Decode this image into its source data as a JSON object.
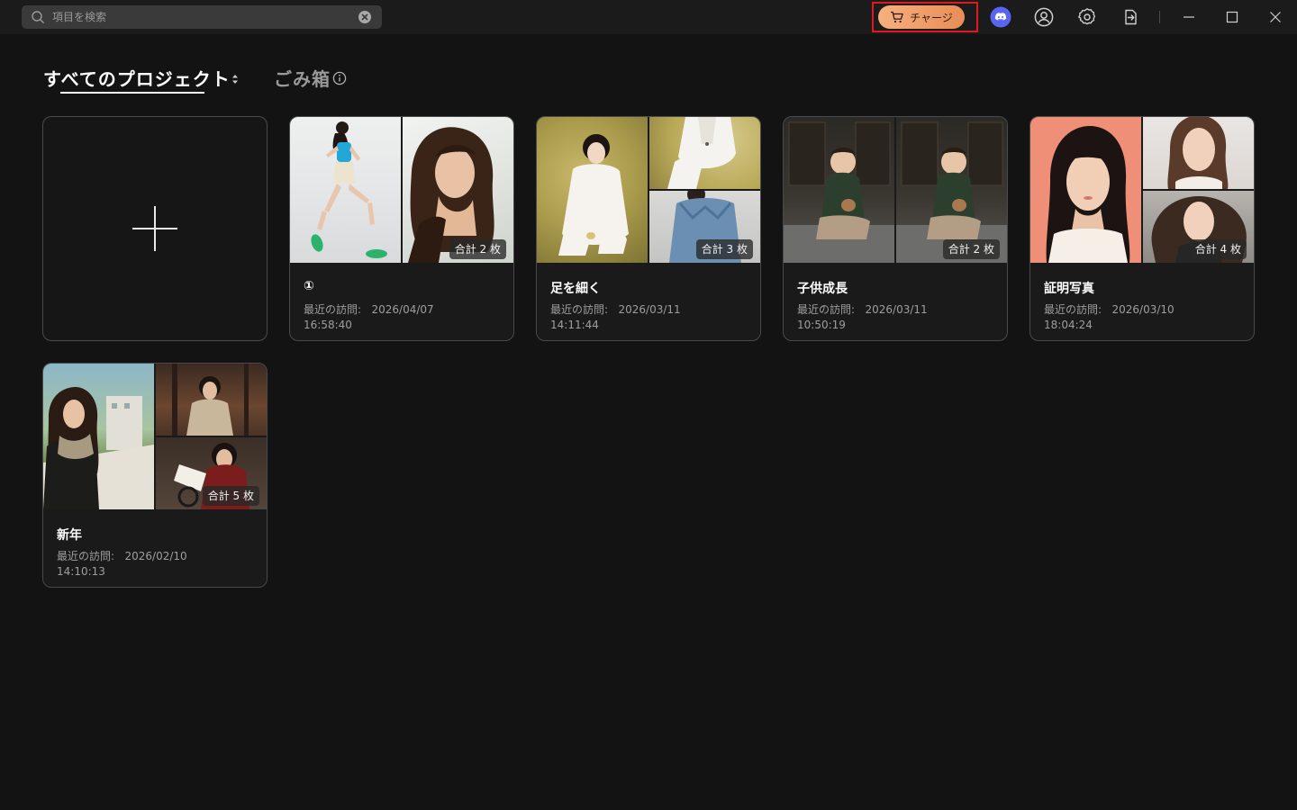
{
  "search": {
    "placeholder": "項目を検索",
    "value": ""
  },
  "header": {
    "charge_label": "チャージ",
    "charge_color": "#ec9662",
    "highlight_color": "#e0191c",
    "icons": [
      "shopping-cart-icon",
      "discord-icon",
      "account-icon",
      "settings-icon",
      "export-icon",
      "minimize-icon",
      "maximize-icon",
      "close-icon"
    ]
  },
  "tabs": {
    "all_projects": "すべてのプロジェクト",
    "trash": "ごみ箱"
  },
  "visit_label": "最近の訪問:",
  "projects": [
    {
      "title": "①",
      "count": "合計 2 枚",
      "date": "2026/04/07",
      "time": "16:58:40"
    },
    {
      "title": "足を細く",
      "count": "合計 3 枚",
      "date": "2026/03/11",
      "time": "14:11:44"
    },
    {
      "title": "子供成長",
      "count": "合計 2 枚",
      "date": "2026/03/11",
      "time": "10:50:19"
    },
    {
      "title": "証明写真",
      "count": "合計 4 枚",
      "date": "2026/03/10",
      "time": "18:04:24"
    },
    {
      "title": "新年",
      "count": "合計 5 枚",
      "date": "2026/02/10",
      "time": "14:10:13"
    }
  ]
}
